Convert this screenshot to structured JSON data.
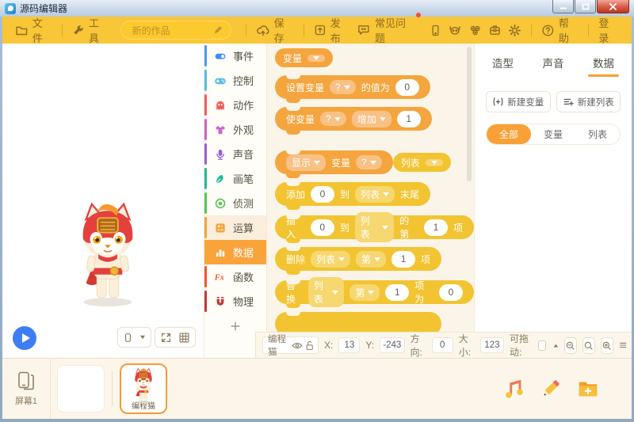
{
  "titlebar": {
    "title": "源码编辑器"
  },
  "toolbar": {
    "file": "文件",
    "tools": "工具",
    "project_name": "新的作品",
    "save": "保存",
    "publish": "发布",
    "faq": "常见问题",
    "help": "帮助",
    "login": "登录"
  },
  "categories": [
    {
      "label": "事件",
      "icon": "toggle-icon",
      "color": "#3e8ef7",
      "strip": "#4c97ff"
    },
    {
      "label": "控制",
      "icon": "gamepad-icon",
      "color": "#56c0e8",
      "strip": "#56c0e8"
    },
    {
      "label": "动作",
      "icon": "ghost-icon",
      "color": "#f25c5c",
      "strip": "#f25c5c"
    },
    {
      "label": "外观",
      "icon": "shirt-icon",
      "color": "#ce62ce",
      "strip": "#ce62ce"
    },
    {
      "label": "声音",
      "icon": "microphone-icon",
      "color": "#9a5fd8",
      "strip": "#9a5fd8"
    },
    {
      "label": "画笔",
      "icon": "pen-icon",
      "color": "#1dbc9c",
      "strip": "#1dbc9c"
    },
    {
      "label": "侦测",
      "icon": "target-icon",
      "color": "#54c751",
      "strip": "#54c751"
    },
    {
      "label": "运算",
      "icon": "calculator-icon",
      "color": "#f5a43b",
      "strip": "#f5a43b",
      "hover": true
    },
    {
      "label": "数据",
      "icon": "bars-icon",
      "color": "#ffffff",
      "strip": "#f9a43b",
      "selected": true
    },
    {
      "label": "函数",
      "icon": "fx-icon",
      "color": "#f2572c",
      "strip": "#f2572c"
    },
    {
      "label": "物理",
      "icon": "magnet-icon",
      "color": "#c43a35",
      "strip": "#c43a35"
    },
    {
      "label": "＋",
      "icon": "plus-icon",
      "color": "#9a9a90",
      "strip": "",
      "add": true
    }
  ],
  "palette": {
    "blocks": [
      {
        "kind": "pill",
        "color": "orange",
        "name": "variable-reporter-block",
        "segs": [
          {
            "t": "tx",
            "v": "变量"
          },
          {
            "t": "cr"
          }
        ]
      },
      {
        "kind": "stack",
        "color": "orange",
        "name": "set-variable-block",
        "segs": [
          {
            "t": "tx",
            "v": "设置变量"
          },
          {
            "t": "dd",
            "v": "?"
          },
          {
            "t": "tx",
            "v": "的值为"
          },
          {
            "t": "ov",
            "v": "0"
          }
        ]
      },
      {
        "kind": "stack",
        "color": "orange",
        "name": "change-variable-block",
        "segs": [
          {
            "t": "tx",
            "v": "使变量"
          },
          {
            "t": "dd",
            "v": "?"
          },
          {
            "t": "dd",
            "v": "增加"
          },
          {
            "t": "ov",
            "v": "1"
          }
        ]
      },
      {
        "kind": "stack",
        "color": "orange",
        "name": "show-variable-block",
        "segs": [
          {
            "t": "dd",
            "v": "显示"
          },
          {
            "t": "tx",
            "v": "变量"
          },
          {
            "t": "dd",
            "v": "?"
          }
        ]
      },
      {
        "kind": "pill",
        "color": "yellow",
        "name": "list-reporter-block",
        "gap_before": true,
        "segs": [
          {
            "t": "tx",
            "v": "列表"
          },
          {
            "t": "cr"
          }
        ]
      },
      {
        "kind": "stack",
        "color": "yellow",
        "name": "append-to-list-block",
        "segs": [
          {
            "t": "tx",
            "v": "添加"
          },
          {
            "t": "ov",
            "v": "0"
          },
          {
            "t": "tx",
            "v": "到"
          },
          {
            "t": "dd",
            "v": "列表"
          },
          {
            "t": "tx",
            "v": "末尾"
          }
        ]
      },
      {
        "kind": "stack",
        "color": "yellow",
        "name": "insert-into-list-block",
        "segs": [
          {
            "t": "tx",
            "v": "插入"
          },
          {
            "t": "ov",
            "v": "0"
          },
          {
            "t": "tx",
            "v": "到"
          },
          {
            "t": "dd",
            "v": "列表"
          },
          {
            "t": "tx",
            "v": "的第"
          },
          {
            "t": "ov",
            "v": "1"
          },
          {
            "t": "tx",
            "v": "项"
          }
        ]
      },
      {
        "kind": "stack",
        "color": "yellow",
        "name": "delete-from-list-block",
        "segs": [
          {
            "t": "tx",
            "v": "删除"
          },
          {
            "t": "dd",
            "v": "列表"
          },
          {
            "t": "dd",
            "v": "第"
          },
          {
            "t": "ov",
            "v": "1"
          },
          {
            "t": "tx",
            "v": "项"
          }
        ]
      },
      {
        "kind": "stack",
        "color": "yellow",
        "name": "replace-in-list-block",
        "segs": [
          {
            "t": "tx",
            "v": "替换"
          },
          {
            "t": "dd",
            "v": "列表"
          },
          {
            "t": "dd",
            "v": "第"
          },
          {
            "t": "ov",
            "v": "1"
          },
          {
            "t": "tx",
            "v": "项 为"
          },
          {
            "t": "ov",
            "v": "0"
          }
        ]
      },
      {
        "kind": "stack",
        "color": "yellow",
        "name": "clipped-list-block",
        "partial": true,
        "segs": []
      }
    ]
  },
  "right_panel": {
    "tabs": [
      {
        "label": "造型",
        "selected": false
      },
      {
        "label": "声音",
        "selected": false
      },
      {
        "label": "数据",
        "selected": true
      }
    ],
    "new_variable": "新建变量",
    "new_list": "新建列表",
    "filters": [
      {
        "label": "全部",
        "selected": true
      },
      {
        "label": "变量",
        "selected": false
      },
      {
        "label": "列表",
        "selected": false
      }
    ]
  },
  "status_bar": {
    "sprite_name": "编程猫",
    "x_label": "X:",
    "x_value": "13",
    "y_label": "Y:",
    "y_value": "-243",
    "direction_label": "方向:",
    "direction_value": "0",
    "size_label": "大小:",
    "size_value": "123",
    "draggable_label": "可拖动:"
  },
  "bottom_panel": {
    "screen_label": "屏幕1",
    "sprite_label": "编程猫"
  }
}
